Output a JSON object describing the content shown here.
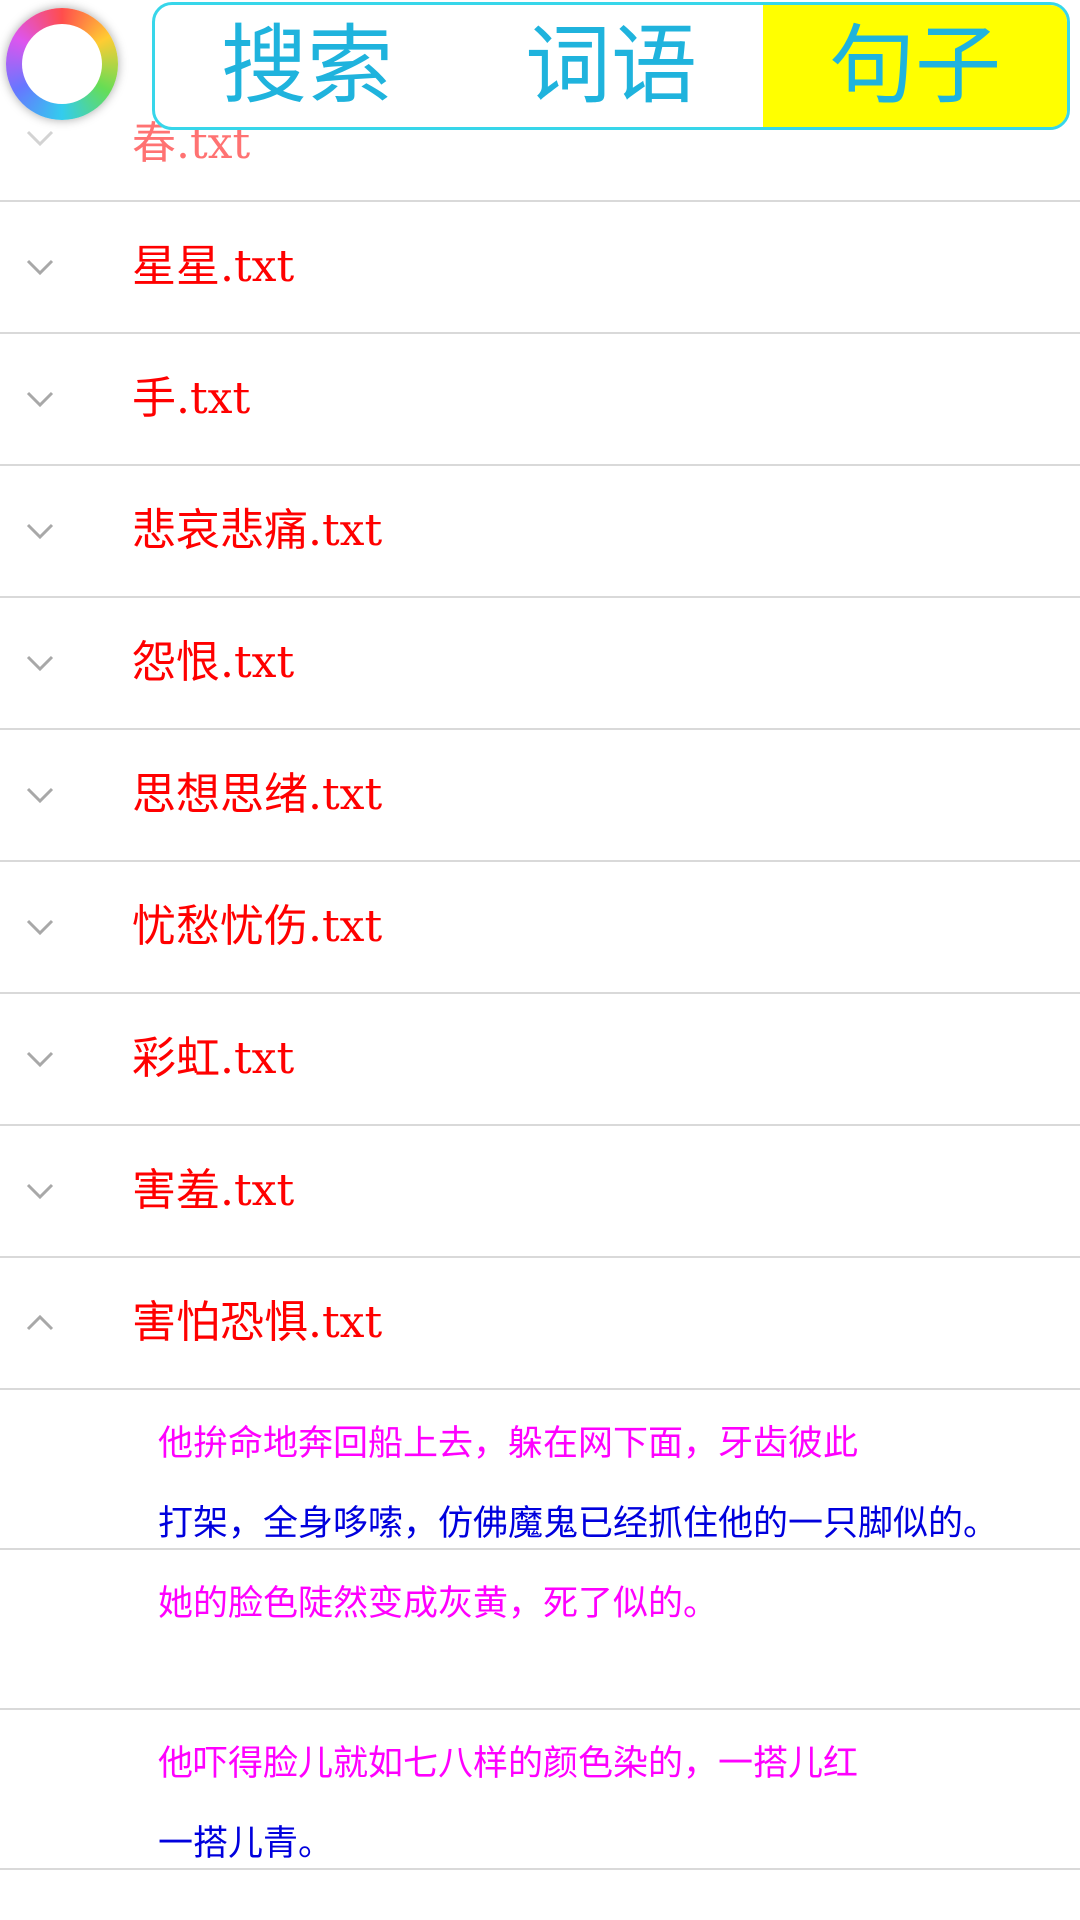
{
  "tabs": [
    {
      "label": "搜索",
      "active": false
    },
    {
      "label": "词语",
      "active": false
    },
    {
      "label": "句子",
      "active": true
    }
  ],
  "colors": {
    "tab_border": "#37d6ea",
    "tab_text": "#1fb3dd",
    "tab_active_bg": "#ffff00",
    "group_text": "#ff0000",
    "sentence_first_line": "#ff00ff",
    "sentence_second_line": "#0000dd",
    "divider": "#d9d9d9"
  },
  "groups": [
    {
      "label": "春.txt",
      "expanded": false
    },
    {
      "label": "星星.txt",
      "expanded": false
    },
    {
      "label": "手.txt",
      "expanded": false
    },
    {
      "label": "悲哀悲痛.txt",
      "expanded": false
    },
    {
      "label": "怨恨.txt",
      "expanded": false
    },
    {
      "label": "思想思绪.txt",
      "expanded": false
    },
    {
      "label": "忧愁忧伤.txt",
      "expanded": false
    },
    {
      "label": "彩虹.txt",
      "expanded": false
    },
    {
      "label": "害羞.txt",
      "expanded": false
    },
    {
      "label": "害怕恐惧.txt",
      "expanded": true
    }
  ],
  "sentences": [
    {
      "line1": "他拚命地奔回船上去，躲在网下面，牙齿彼此",
      "line2": "打架，全身哆嗦，仿佛魔鬼已经抓住他的一只脚似的。"
    },
    {
      "line1": "她的脸色陡然变成灰黄，死了似的。",
      "line2": ""
    },
    {
      "line1": "他吓得脸儿就如七八样的颜色染的，一搭儿红",
      "line2": "一搭儿青。"
    }
  ]
}
